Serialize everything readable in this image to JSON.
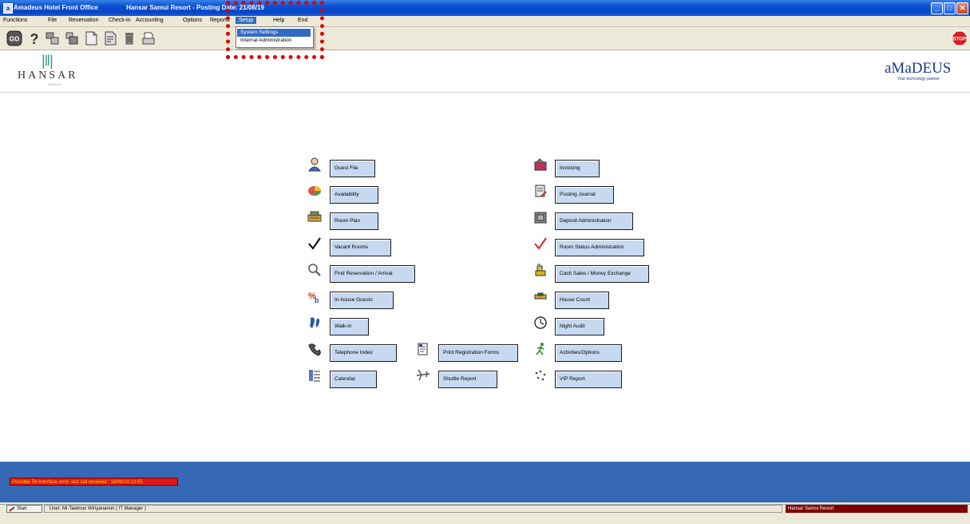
{
  "window": {
    "app_title": "Amadeus Hotel Front Office",
    "subtitle": "Hansar Samui Resort - Posting Date:  21/08/19",
    "controls": [
      "minimize",
      "maximize",
      "close"
    ]
  },
  "menu": {
    "items": [
      "Functions",
      "File",
      "Reservation",
      "Check-in",
      "Accounting",
      "Options",
      "Reports",
      "Setup",
      "Help",
      "End"
    ],
    "active": "Setup",
    "dropdown": [
      "System Settings",
      "Internal Administration"
    ],
    "dropdown_selected": "System Settings"
  },
  "toolbar": {
    "icons": [
      "go-icon",
      "help-icon",
      "copy-icon",
      "paste-icon",
      "new-document-icon",
      "edit-document-icon",
      "trash-icon",
      "print-icon"
    ],
    "stop_label": "STOP",
    "go_label": "GO"
  },
  "header": {
    "hotel_logo": "HANSAR",
    "hotel_logo_sub": "SAMUI",
    "vendor_logo": "aMaDEUS",
    "vendor_tagline": "Your technology partner"
  },
  "functions": {
    "left": [
      {
        "label": "Guest File",
        "icon": "guest-icon"
      },
      {
        "label": "Availability",
        "icon": "availability-icon"
      },
      {
        "label": "Room Plan",
        "icon": "room-plan-icon"
      },
      {
        "label": "Vacant Rooms",
        "icon": "checkmark-icon"
      },
      {
        "label": "Find Reservation / Arrival",
        "icon": "magnifier-icon"
      },
      {
        "label": "In-house Guests",
        "icon": "in-house-icon"
      },
      {
        "label": "Walk-in",
        "icon": "footprint-icon"
      },
      {
        "label": "Telephone Index",
        "icon": "telephone-icon"
      },
      {
        "label": "Calendar",
        "icon": "calendar-icon"
      }
    ],
    "middle": [
      {
        "label": "Print Registration Forms",
        "icon": "registration-form-icon"
      },
      {
        "label": "Shuttle Report",
        "icon": "airplane-icon"
      }
    ],
    "right": [
      {
        "label": "Invoicing",
        "icon": "invoice-icon"
      },
      {
        "label": "Posting Journal",
        "icon": "journal-icon"
      },
      {
        "label": "Deposit Administration",
        "icon": "deposit-icon"
      },
      {
        "label": "Room Status Administration",
        "icon": "red-checkmark-icon"
      },
      {
        "label": "Cash Sales / Money Exchange",
        "icon": "cash-icon"
      },
      {
        "label": "House Count",
        "icon": "house-count-icon"
      },
      {
        "label": "Night Audit",
        "icon": "clock-icon"
      },
      {
        "label": "Activities/Options",
        "icon": "runner-icon"
      },
      {
        "label": "VIP Report",
        "icon": "vip-icon"
      }
    ]
  },
  "status": {
    "error": "Possible Tel Interface error, last call received : 18/08/19 13:05",
    "start_label": "Start",
    "user": "User: Mr.Tawinun Wiriyananon ( IT Manager )",
    "resort": "Hansar Samui Resort"
  },
  "colors": {
    "titlebar": "#0a4fd0",
    "button_fill": "#c6d9f1",
    "bottom_bar": "#3669b5",
    "error": "#e01818",
    "resort_box": "#7d0000",
    "highlight": "#e00000"
  }
}
